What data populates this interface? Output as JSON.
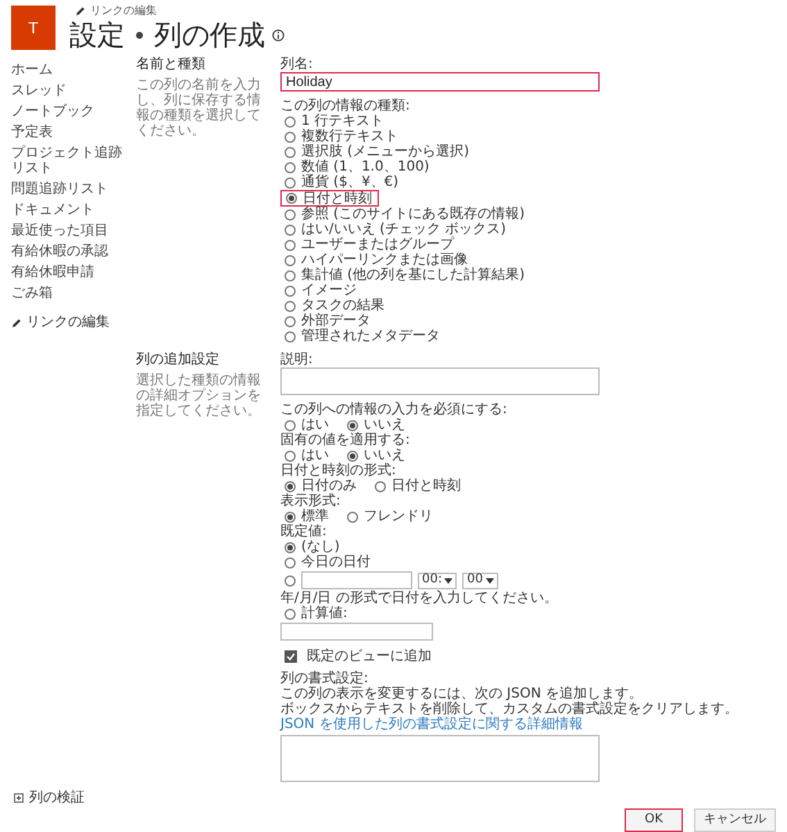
{
  "header": {
    "logo": "T",
    "edit_link": "リンクの編集",
    "breadcrumb": [
      "設定",
      "列の作成"
    ]
  },
  "nav": {
    "items": [
      "ホーム",
      "スレッド",
      "ノートブック",
      "予定表",
      "プロジェクト追跡リスト",
      "問題追跡リスト",
      "ドキュメント",
      "最近使った項目",
      "有給休暇の承認",
      "有給休暇申請",
      "ごみ箱"
    ],
    "edit_link": "リンクの編集"
  },
  "sections": [
    {
      "title": "名前と種類",
      "description": "この列の名前を入力し、列に保存する情報の種類を選択してください。"
    },
    {
      "title": "列の追加設定",
      "description": "選択した種類の情報の詳細オプションを指定してください。"
    }
  ],
  "column_name": {
    "label": "列名:",
    "value": "Holiday",
    "highlighted": true
  },
  "type": {
    "label": "この列の情報の種類:",
    "options": [
      {
        "label": "1 行テキスト",
        "selected": false,
        "highlighted": false
      },
      {
        "label": "複数行テキスト",
        "selected": false,
        "highlighted": false
      },
      {
        "label": "選択肢 (メニューから選択)",
        "selected": false,
        "highlighted": false
      },
      {
        "label": "数値 (1、1.0、100)",
        "selected": false,
        "highlighted": false
      },
      {
        "label": "通貨 ($、¥、€)",
        "selected": false,
        "highlighted": false
      },
      {
        "label": "日付と時刻",
        "selected": true,
        "highlighted": true
      },
      {
        "label": "参照 (このサイトにある既存の情報)",
        "selected": false,
        "highlighted": false
      },
      {
        "label": "はい/いいえ (チェック ボックス)",
        "selected": false,
        "highlighted": false
      },
      {
        "label": "ユーザーまたはグループ",
        "selected": false,
        "highlighted": false
      },
      {
        "label": "ハイパーリンクまたは画像",
        "selected": false,
        "highlighted": false
      },
      {
        "label": "集計値 (他の列を基にした計算結果)",
        "selected": false,
        "highlighted": false
      },
      {
        "label": "イメージ",
        "selected": false,
        "highlighted": false
      },
      {
        "label": "タスクの結果",
        "selected": false,
        "highlighted": false
      },
      {
        "label": "外部データ",
        "selected": false,
        "highlighted": false
      },
      {
        "label": "管理されたメタデータ",
        "selected": false,
        "highlighted": false
      }
    ]
  },
  "description": {
    "label": "説明:"
  },
  "choice_groups": [
    {
      "label": "この列への情報の入力を必須にする:",
      "options": [
        {
          "label": "はい",
          "selected": false
        },
        {
          "label": "いいえ",
          "selected": true
        }
      ]
    },
    {
      "label": "固有の値を適用する:",
      "options": [
        {
          "label": "はい",
          "selected": false
        },
        {
          "label": "いいえ",
          "selected": true
        }
      ]
    },
    {
      "label": "日付と時刻の形式:",
      "options": [
        {
          "label": "日付のみ",
          "selected": true
        },
        {
          "label": "日付と時刻",
          "selected": false
        }
      ]
    },
    {
      "label": "表示形式:",
      "options": [
        {
          "label": "標準",
          "selected": true
        },
        {
          "label": "フレンドリ",
          "selected": false
        }
      ]
    }
  ],
  "default_value": {
    "label": "既定値:",
    "options": [
      {
        "kind": "text",
        "label": "(なし)",
        "selected": true
      },
      {
        "kind": "text",
        "label": "今日の日付",
        "selected": false
      },
      {
        "kind": "date",
        "selected": false,
        "hour": "00:",
        "minute": "00",
        "hint": "年/月/日 の形式で日付を入力してください。"
      },
      {
        "kind": "calculated",
        "label": "計算値:",
        "selected": false
      }
    ]
  },
  "add_to_default_view": {
    "label": "既定のビューに追加",
    "checked": true
  },
  "formatting": {
    "label": "列の書式設定:",
    "lines": [
      "この列の表示を変更するには、次の JSON を追加します。",
      "ボックスからテキストを削除して、カスタムの書式設定をクリアします。"
    ],
    "link": "JSON を使用した列の書式設定に関する詳細情報"
  },
  "validation": {
    "label": "列の検証"
  },
  "buttons": [
    {
      "label": "OK",
      "highlighted": true
    },
    {
      "label": "キャンセル",
      "highlighted": false
    }
  ]
}
